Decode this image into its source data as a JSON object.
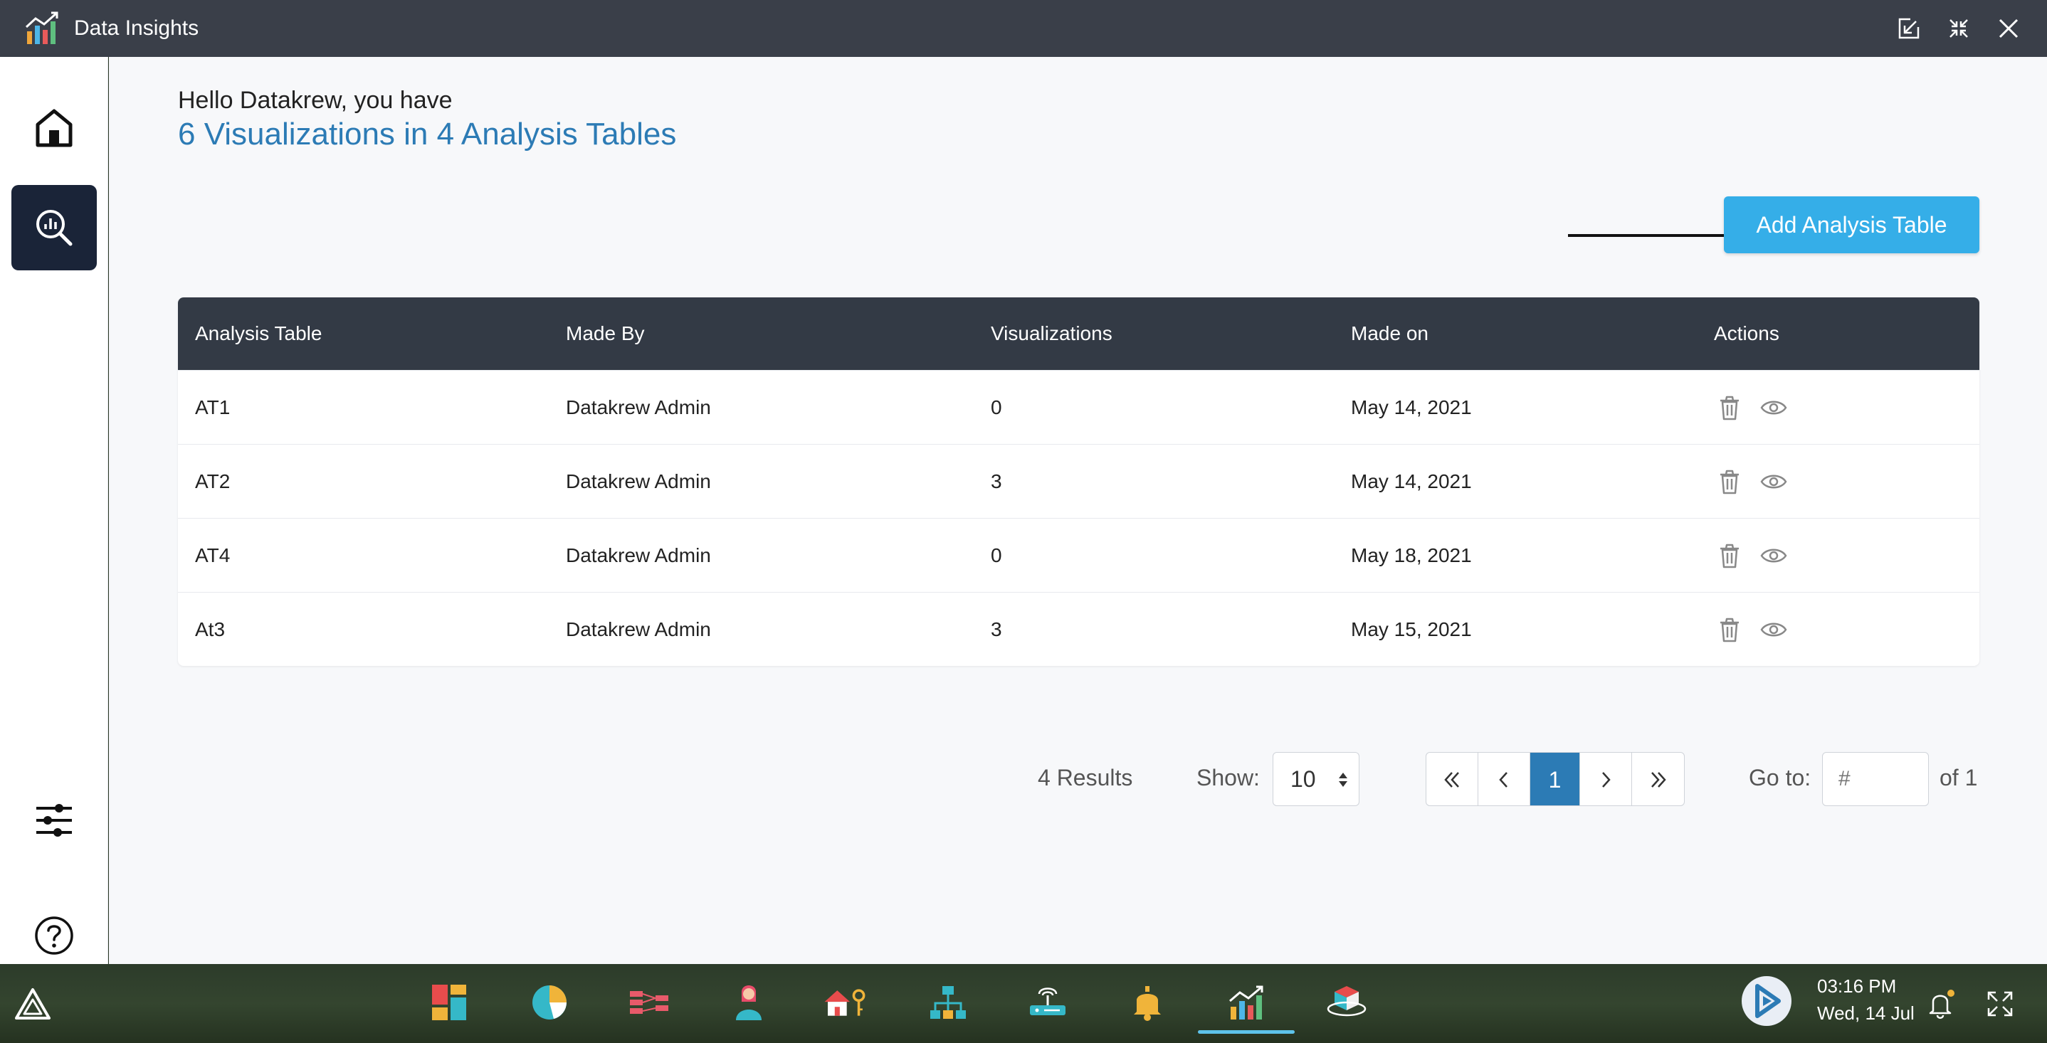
{
  "window": {
    "title": "Data Insights"
  },
  "main": {
    "greeting": "Hello Datakrew, you have",
    "summary": "6 Visualizations in 4 Analysis Tables",
    "add_button": "Add Analysis Table"
  },
  "table": {
    "headers": [
      "Analysis Table",
      "Made By",
      "Visualizations",
      "Made on",
      "Actions"
    ],
    "rows": [
      {
        "name": "AT1",
        "made_by": "Datakrew Admin",
        "visualizations": "0",
        "made_on": "May 14, 2021"
      },
      {
        "name": "AT2",
        "made_by": "Datakrew Admin",
        "visualizations": "3",
        "made_on": "May 14, 2021"
      },
      {
        "name": "AT4",
        "made_by": "Datakrew Admin",
        "visualizations": "0",
        "made_on": "May 18, 2021"
      },
      {
        "name": "At3",
        "made_by": "Datakrew Admin",
        "visualizations": "3",
        "made_on": "May 15, 2021"
      }
    ]
  },
  "pagination": {
    "results": "4 Results",
    "show_label": "Show:",
    "show_value": "10",
    "current_page": "1",
    "goto_label": "Go to:",
    "goto_placeholder": "#",
    "of_total": "of 1"
  },
  "taskbar": {
    "time": "03:16 PM",
    "date": "Wed, 14 Jul"
  },
  "colors": {
    "accent": "#2c7bb5",
    "button": "#35aee8",
    "header": "#333a45",
    "sidebar_active": "#1a2438",
    "titlebar": "#3a3f49"
  }
}
